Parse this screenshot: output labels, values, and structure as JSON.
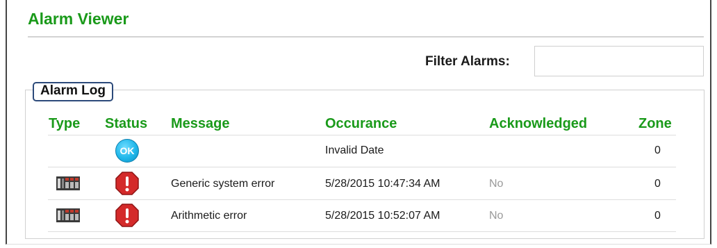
{
  "title": "Alarm Viewer",
  "filter": {
    "label": "Filter Alarms:",
    "value": "",
    "placeholder": ""
  },
  "log": {
    "tab_label": "Alarm Log",
    "columns": {
      "type": "Type",
      "status": "Status",
      "message": "Message",
      "occurance": "Occurance",
      "acknowledged": "Acknowledged",
      "zone": "Zone"
    },
    "rows": [
      {
        "type_icon": "",
        "status_icon": "ok-icon",
        "status_text": "OK",
        "message": "",
        "occurance": "Invalid Date",
        "acknowledged": "",
        "zone": "0"
      },
      {
        "type_icon": "plc-icon",
        "status_icon": "error-icon",
        "message": "Generic system error",
        "occurance": "5/28/2015 10:47:34 AM",
        "acknowledged": "No",
        "zone": "0"
      },
      {
        "type_icon": "plc-icon",
        "status_icon": "error-icon",
        "message": "Arithmetic error",
        "occurance": "5/28/2015 10:52:07 AM",
        "acknowledged": "No",
        "zone": "0"
      }
    ]
  },
  "colors": {
    "accent_green": "#1a9a1a",
    "ok_blue": "#1fb7ea",
    "error_red": "#d42a2a",
    "muted": "#9a9a9a"
  }
}
